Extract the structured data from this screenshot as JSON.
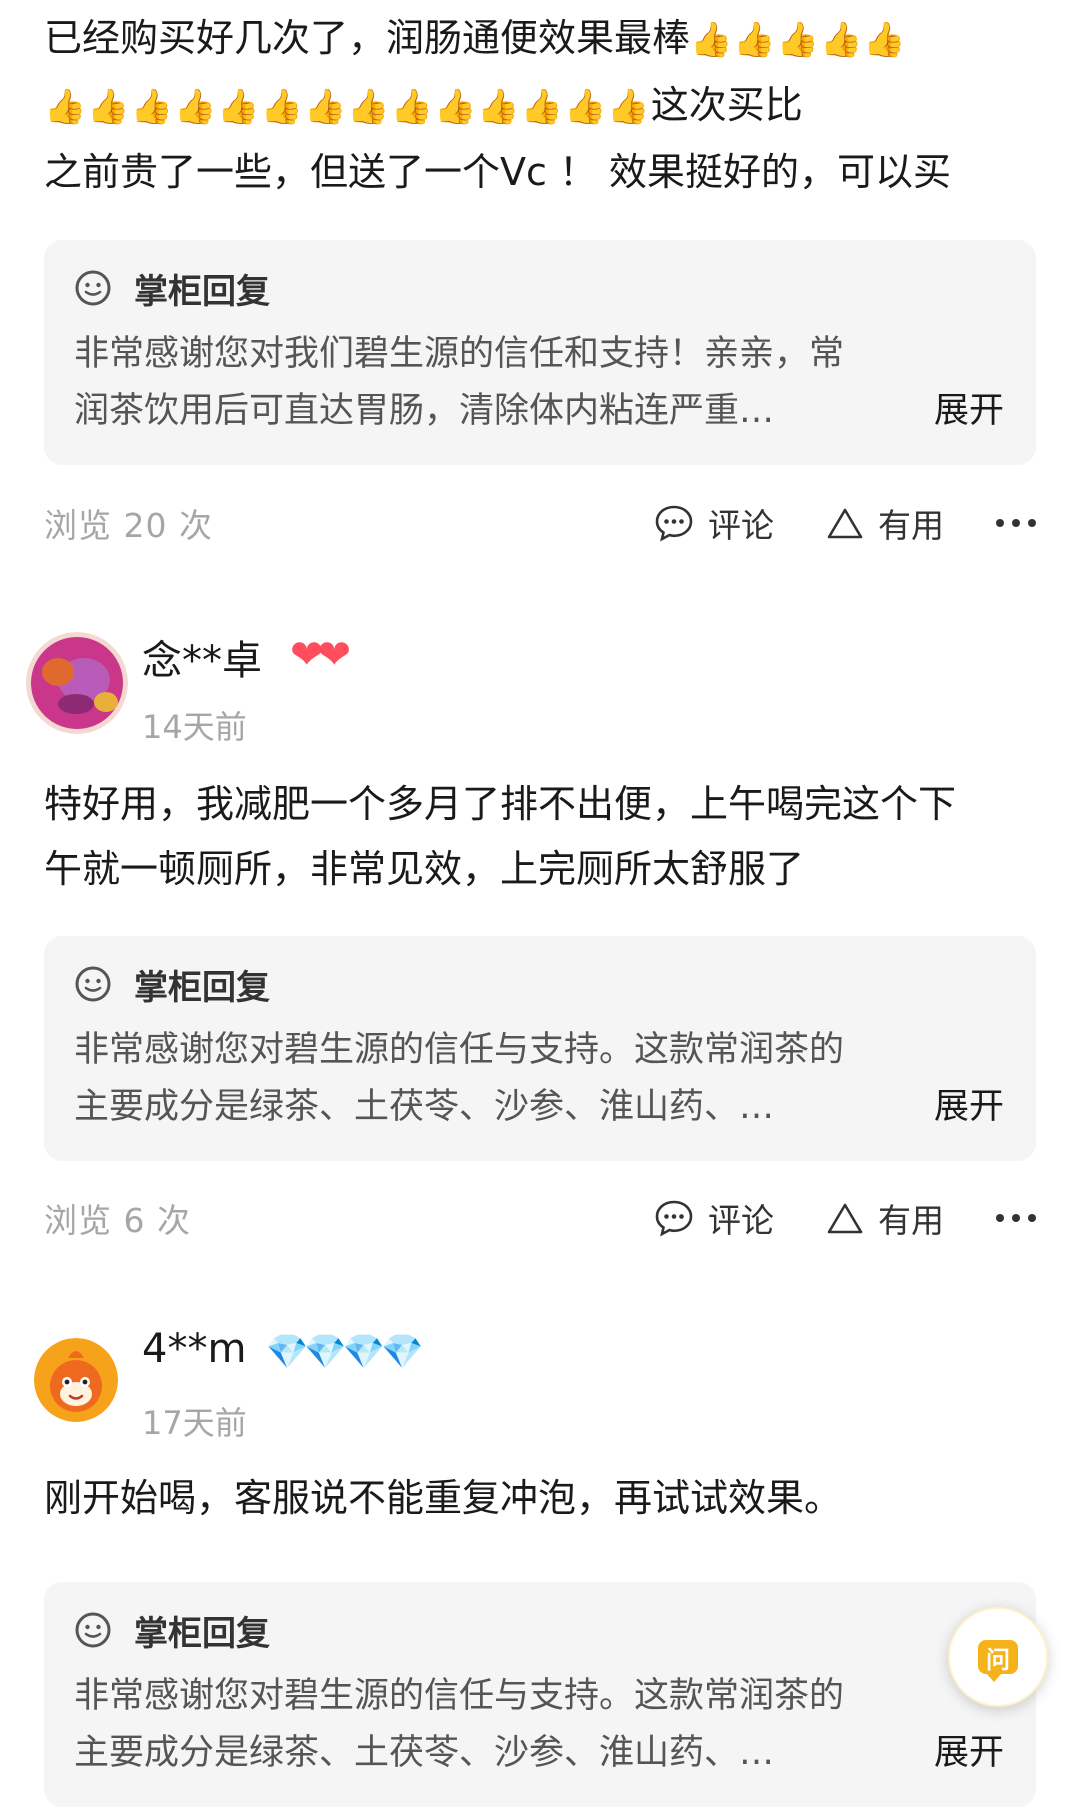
{
  "reviews": [
    {
      "text_parts": [
        "已经购买好几次了，润肠通便效果最棒",
        "这次买比",
        "之前贵了一些，但送了一个Vc ！ 效果挺好的，可以买"
      ],
      "reply": {
        "title": "掌柜回复",
        "line1": "非常感谢您对我们碧生源的信任和支持！亲亲，常",
        "line2": "润茶饮用后可直达胃肠，清除体内粘连严重…",
        "expand": "展开"
      },
      "views": "浏览 20 次",
      "comment_label": "评论",
      "useful_label": "有用"
    },
    {
      "username": "念**卓",
      "badge": "❤❤",
      "time": "14天前",
      "text_line1": "特好用，我减肥一个多月了排不出便，上午喝完这个下",
      "text_line2": "午就一顿厕所，非常见效，上完厕所太舒服了",
      "reply": {
        "title": "掌柜回复",
        "line1": "非常感谢您对碧生源的信任与支持。这款常润茶的",
        "line2": "主要成分是绿茶、土茯苓、沙参、淮山药、…",
        "expand": "展开"
      },
      "views": "浏览 6 次",
      "comment_label": "评论",
      "useful_label": "有用"
    },
    {
      "username": "4**m",
      "badge": "💎💎💎💎",
      "time": "17天前",
      "text_line1": "刚开始喝，客服说不能重复冲泡，再试试效果。",
      "reply": {
        "title": "掌柜回复",
        "line1": "非常感谢您对碧生源的信任与支持。这款常润茶的",
        "line2": "主要成分是绿茶、土茯苓、沙参、淮山药、…",
        "expand": "展开"
      }
    }
  ],
  "ask_button": "问",
  "emoji": {
    "thumbs_up": "👍",
    "row1_count": 5,
    "row2_count": 14
  },
  "colors": {
    "reply_bg": "#f5f5f5",
    "muted": "#a6a6a6",
    "ask": "#f6b21a",
    "heart": "#ff4d5e",
    "diamond": "#35b8f0"
  }
}
